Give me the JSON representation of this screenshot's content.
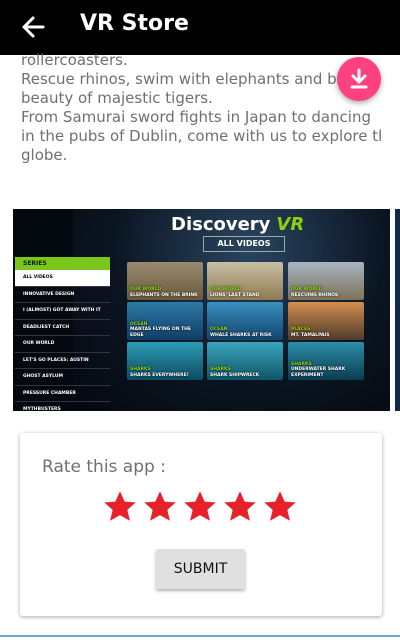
{
  "app_bar": {
    "title": "VR Store",
    "back_icon": "arrow-back-icon"
  },
  "description": {
    "lines": [
      "rollercoasters.",
      "Rescue rhinos, swim with elephants and bask",
      "beauty of majestic tigers.",
      "From Samurai sword fights in Japan to dancing",
      "in the pubs of Dublin, come with us to explore the",
      "globe."
    ]
  },
  "download_fab": {
    "icon": "download-icon",
    "color": "#ff4081"
  },
  "screenshot": {
    "brand": "Discovery",
    "brand_suffix": "VR",
    "all_videos": "ALL VIDEOS",
    "menu_header": "SERIES",
    "menu_items": [
      "ALL VIDEOS",
      "INNOVATIVE DESIGN",
      "I (ALMOST) GOT AWAY WITH IT",
      "DEADLIEST CATCH",
      "OUR WORLD",
      "LET'S GO PLACES: AUSTIN",
      "GHOST ASYLUM",
      "PRESSURE CHAMBER",
      "MYTHBUSTERS"
    ],
    "tiles": [
      {
        "tag": "OUR WORLD",
        "title": "ELEPHANTS ON THE BRINK"
      },
      {
        "tag": "OUR WORLD",
        "title": "LIONS' LAST STAND"
      },
      {
        "tag": "OUR WORLD",
        "title": "RESCUING RHINOS"
      },
      {
        "tag": "OCEAN",
        "title": "MANTAS FLYING ON THE EDGE"
      },
      {
        "tag": "OCEAN",
        "title": "WHALE SHARKS AT RISK"
      },
      {
        "tag": "PLACES",
        "title": "MT. TAMALPAIS"
      },
      {
        "tag": "SHARKS",
        "title": "SHARKS EVERYWHERE!"
      },
      {
        "tag": "SHARKS",
        "title": "SHARK SHIPWRECK"
      },
      {
        "tag": "SHARKS",
        "title": "UNDERWATER SHARK EXPERIMENT"
      }
    ]
  },
  "rating": {
    "label": "Rate this app :",
    "stars": 5,
    "star_color": "#e8202a",
    "submit_label": "SUBMIT"
  }
}
